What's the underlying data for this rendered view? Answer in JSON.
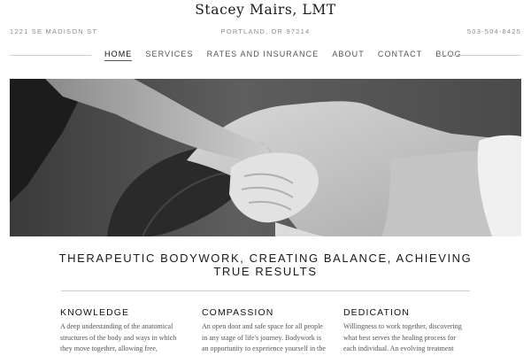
{
  "header": {
    "title": "Stacey Mairs, LMT",
    "address": "1221 SE MADISON ST",
    "city": "PORTLAND, OR 97214",
    "phone": "503-504-8425"
  },
  "nav": {
    "items": [
      "HOME",
      "SERVICES",
      "RATES AND INSURANCE",
      "ABOUT",
      "CONTACT",
      "BLOG"
    ],
    "active": "HOME"
  },
  "hero": {
    "headline_line1": "THERAPEUTIC BODYWORK, CREATING BALANCE, ACHIEVING",
    "headline_line2": "TRUE RESULTS"
  },
  "features": [
    {
      "title": "KNOWLEDGE",
      "lines": [
        "A deep understanding of the anatomical",
        "structures of the body and ways in which",
        "they move together, allowing free,"
      ]
    },
    {
      "title": "COMPASSION",
      "lines": [
        "An open door and safe space for all people",
        "in any stage of life's journey. Bodywork is",
        "an opportunity to experience yourself in the"
      ]
    },
    {
      "title": "DEDICATION",
      "lines": [
        "Willingness to work together, discovering",
        "what best serves the healing process for",
        "each individual. An evolving treatment"
      ]
    }
  ]
}
